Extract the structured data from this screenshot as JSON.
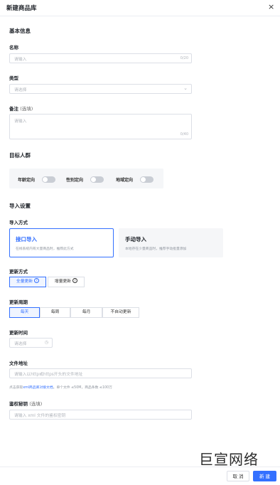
{
  "header": {
    "title": "新建商品库",
    "close_symbol": "×"
  },
  "basic": {
    "section_title": "基本信息",
    "name": {
      "label": "名称",
      "placeholder": "请输入",
      "count": "0/20"
    },
    "type": {
      "label": "类型",
      "placeholder": "请选择"
    },
    "note": {
      "label": "备注",
      "optional": "(选填)",
      "placeholder": "请输入",
      "count": "0/40"
    }
  },
  "target": {
    "section_title": "目标人群",
    "toggles": [
      {
        "label": "年龄定向",
        "on": false
      },
      {
        "label": "性别定向",
        "on": false
      },
      {
        "label": "地域定向",
        "on": false
      }
    ]
  },
  "import": {
    "section_title": "导入设置",
    "mode_label": "导入方式",
    "cards": [
      {
        "title": "接口导入",
        "desc": "在线系统内有大量商品时，推荐此方式",
        "selected": true
      },
      {
        "title": "手动导入",
        "desc": "本地存在少量商品时，推荐手动批量添加",
        "selected": false
      }
    ],
    "update_mode": {
      "label": "更新方式",
      "options": [
        "全量更新",
        "增量更新"
      ],
      "selected": 0
    },
    "update_period": {
      "label": "更新周期",
      "options": [
        "每天",
        "每周",
        "每月",
        "不自动更新"
      ],
      "selected": 0
    },
    "update_time": {
      "label": "更新时间",
      "placeholder": "请选择"
    },
    "file_url": {
      "label": "文件地址",
      "placeholder": "请输入以http或https开头的文件地址",
      "hint_prefix": "点击获取",
      "hint_link": "xml商品库对接文档",
      "hint_suffix": "。单个文件 ≤50M，商品条数 ≤100万"
    },
    "auth_key": {
      "label": "鉴权秘钥",
      "optional": "(选填)",
      "placeholder": "请输入 xml 文件的鉴权密钥"
    }
  },
  "watermark": "巨宣网络",
  "footer": {
    "cancel": "取 消",
    "ok": "新 建"
  },
  "colors": {
    "accent": "#3370ff",
    "toggle_off": "#c9cdd4"
  }
}
